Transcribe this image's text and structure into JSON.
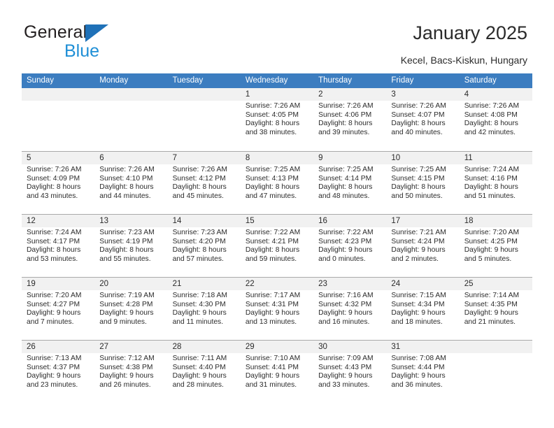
{
  "brand": {
    "line1": "General",
    "line2": "Blue",
    "triangle_color": "#1f71b8",
    "line2_color": "#1f8fd6"
  },
  "header": {
    "title": "January 2025",
    "subtitle": "Kecel, Bacs-Kiskun, Hungary"
  },
  "calendar": {
    "header_bg": "#3c7dc0",
    "day_band_bg": "#f1f1f1",
    "weekdays": [
      "Sunday",
      "Monday",
      "Tuesday",
      "Wednesday",
      "Thursday",
      "Friday",
      "Saturday"
    ],
    "weeks": [
      [
        {
          "num": "",
          "empty": true
        },
        {
          "num": "",
          "empty": true
        },
        {
          "num": "",
          "empty": true
        },
        {
          "num": "1",
          "sunrise": "Sunrise: 7:26 AM",
          "sunset": "Sunset: 4:05 PM",
          "daylight1": "Daylight: 8 hours",
          "daylight2": "and 38 minutes."
        },
        {
          "num": "2",
          "sunrise": "Sunrise: 7:26 AM",
          "sunset": "Sunset: 4:06 PM",
          "daylight1": "Daylight: 8 hours",
          "daylight2": "and 39 minutes."
        },
        {
          "num": "3",
          "sunrise": "Sunrise: 7:26 AM",
          "sunset": "Sunset: 4:07 PM",
          "daylight1": "Daylight: 8 hours",
          "daylight2": "and 40 minutes."
        },
        {
          "num": "4",
          "sunrise": "Sunrise: 7:26 AM",
          "sunset": "Sunset: 4:08 PM",
          "daylight1": "Daylight: 8 hours",
          "daylight2": "and 42 minutes."
        }
      ],
      [
        {
          "num": "5",
          "sunrise": "Sunrise: 7:26 AM",
          "sunset": "Sunset: 4:09 PM",
          "daylight1": "Daylight: 8 hours",
          "daylight2": "and 43 minutes."
        },
        {
          "num": "6",
          "sunrise": "Sunrise: 7:26 AM",
          "sunset": "Sunset: 4:10 PM",
          "daylight1": "Daylight: 8 hours",
          "daylight2": "and 44 minutes."
        },
        {
          "num": "7",
          "sunrise": "Sunrise: 7:26 AM",
          "sunset": "Sunset: 4:12 PM",
          "daylight1": "Daylight: 8 hours",
          "daylight2": "and 45 minutes."
        },
        {
          "num": "8",
          "sunrise": "Sunrise: 7:25 AM",
          "sunset": "Sunset: 4:13 PM",
          "daylight1": "Daylight: 8 hours",
          "daylight2": "and 47 minutes."
        },
        {
          "num": "9",
          "sunrise": "Sunrise: 7:25 AM",
          "sunset": "Sunset: 4:14 PM",
          "daylight1": "Daylight: 8 hours",
          "daylight2": "and 48 minutes."
        },
        {
          "num": "10",
          "sunrise": "Sunrise: 7:25 AM",
          "sunset": "Sunset: 4:15 PM",
          "daylight1": "Daylight: 8 hours",
          "daylight2": "and 50 minutes."
        },
        {
          "num": "11",
          "sunrise": "Sunrise: 7:24 AM",
          "sunset": "Sunset: 4:16 PM",
          "daylight1": "Daylight: 8 hours",
          "daylight2": "and 51 minutes."
        }
      ],
      [
        {
          "num": "12",
          "sunrise": "Sunrise: 7:24 AM",
          "sunset": "Sunset: 4:17 PM",
          "daylight1": "Daylight: 8 hours",
          "daylight2": "and 53 minutes."
        },
        {
          "num": "13",
          "sunrise": "Sunrise: 7:23 AM",
          "sunset": "Sunset: 4:19 PM",
          "daylight1": "Daylight: 8 hours",
          "daylight2": "and 55 minutes."
        },
        {
          "num": "14",
          "sunrise": "Sunrise: 7:23 AM",
          "sunset": "Sunset: 4:20 PM",
          "daylight1": "Daylight: 8 hours",
          "daylight2": "and 57 minutes."
        },
        {
          "num": "15",
          "sunrise": "Sunrise: 7:22 AM",
          "sunset": "Sunset: 4:21 PM",
          "daylight1": "Daylight: 8 hours",
          "daylight2": "and 59 minutes."
        },
        {
          "num": "16",
          "sunrise": "Sunrise: 7:22 AM",
          "sunset": "Sunset: 4:23 PM",
          "daylight1": "Daylight: 9 hours",
          "daylight2": "and 0 minutes."
        },
        {
          "num": "17",
          "sunrise": "Sunrise: 7:21 AM",
          "sunset": "Sunset: 4:24 PM",
          "daylight1": "Daylight: 9 hours",
          "daylight2": "and 2 minutes."
        },
        {
          "num": "18",
          "sunrise": "Sunrise: 7:20 AM",
          "sunset": "Sunset: 4:25 PM",
          "daylight1": "Daylight: 9 hours",
          "daylight2": "and 5 minutes."
        }
      ],
      [
        {
          "num": "19",
          "sunrise": "Sunrise: 7:20 AM",
          "sunset": "Sunset: 4:27 PM",
          "daylight1": "Daylight: 9 hours",
          "daylight2": "and 7 minutes."
        },
        {
          "num": "20",
          "sunrise": "Sunrise: 7:19 AM",
          "sunset": "Sunset: 4:28 PM",
          "daylight1": "Daylight: 9 hours",
          "daylight2": "and 9 minutes."
        },
        {
          "num": "21",
          "sunrise": "Sunrise: 7:18 AM",
          "sunset": "Sunset: 4:30 PM",
          "daylight1": "Daylight: 9 hours",
          "daylight2": "and 11 minutes."
        },
        {
          "num": "22",
          "sunrise": "Sunrise: 7:17 AM",
          "sunset": "Sunset: 4:31 PM",
          "daylight1": "Daylight: 9 hours",
          "daylight2": "and 13 minutes."
        },
        {
          "num": "23",
          "sunrise": "Sunrise: 7:16 AM",
          "sunset": "Sunset: 4:32 PM",
          "daylight1": "Daylight: 9 hours",
          "daylight2": "and 16 minutes."
        },
        {
          "num": "24",
          "sunrise": "Sunrise: 7:15 AM",
          "sunset": "Sunset: 4:34 PM",
          "daylight1": "Daylight: 9 hours",
          "daylight2": "and 18 minutes."
        },
        {
          "num": "25",
          "sunrise": "Sunrise: 7:14 AM",
          "sunset": "Sunset: 4:35 PM",
          "daylight1": "Daylight: 9 hours",
          "daylight2": "and 21 minutes."
        }
      ],
      [
        {
          "num": "26",
          "sunrise": "Sunrise: 7:13 AM",
          "sunset": "Sunset: 4:37 PM",
          "daylight1": "Daylight: 9 hours",
          "daylight2": "and 23 minutes."
        },
        {
          "num": "27",
          "sunrise": "Sunrise: 7:12 AM",
          "sunset": "Sunset: 4:38 PM",
          "daylight1": "Daylight: 9 hours",
          "daylight2": "and 26 minutes."
        },
        {
          "num": "28",
          "sunrise": "Sunrise: 7:11 AM",
          "sunset": "Sunset: 4:40 PM",
          "daylight1": "Daylight: 9 hours",
          "daylight2": "and 28 minutes."
        },
        {
          "num": "29",
          "sunrise": "Sunrise: 7:10 AM",
          "sunset": "Sunset: 4:41 PM",
          "daylight1": "Daylight: 9 hours",
          "daylight2": "and 31 minutes."
        },
        {
          "num": "30",
          "sunrise": "Sunrise: 7:09 AM",
          "sunset": "Sunset: 4:43 PM",
          "daylight1": "Daylight: 9 hours",
          "daylight2": "and 33 minutes."
        },
        {
          "num": "31",
          "sunrise": "Sunrise: 7:08 AM",
          "sunset": "Sunset: 4:44 PM",
          "daylight1": "Daylight: 9 hours",
          "daylight2": "and 36 minutes."
        },
        {
          "num": "",
          "empty": true
        }
      ]
    ]
  }
}
